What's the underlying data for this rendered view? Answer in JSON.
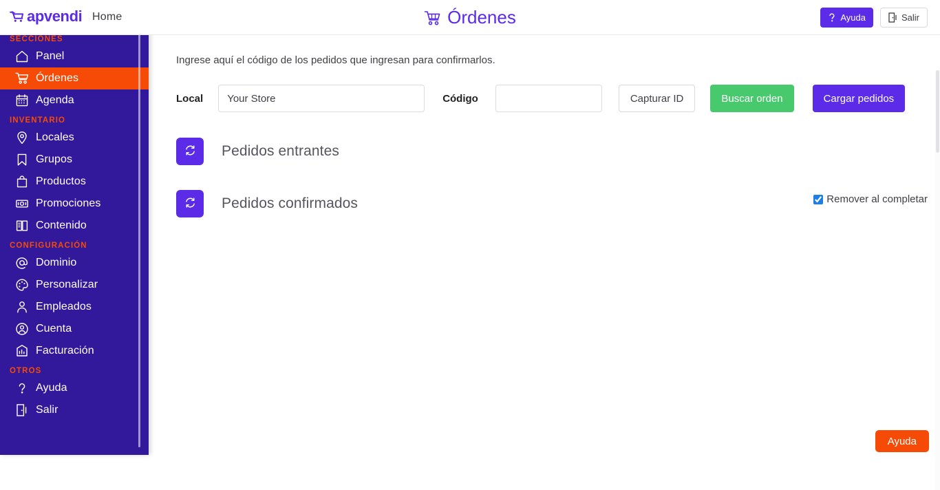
{
  "header": {
    "brand": "apvendi",
    "brand_icon": "shopping-cart-icon",
    "nav_home": "Home",
    "title": "Órdenes",
    "title_icon": "shopping-cart-icon",
    "help_label": "Ayuda",
    "help_icon": "question-mark-icon",
    "exit_label": "Salir",
    "exit_icon": "exit-door-icon",
    "accent_purple": "#5B2BE8"
  },
  "sidebar": {
    "bg_color": "#32189B",
    "active_color": "#F64B06",
    "group_label_color": "#F64B06",
    "groups": [
      {
        "label": "SECCIONES",
        "items": [
          {
            "label": "Panel",
            "icon": "home-icon",
            "active": false
          },
          {
            "label": "Órdenes",
            "icon": "shopping-cart-icon",
            "active": true
          },
          {
            "label": "Agenda",
            "icon": "calendar-icon",
            "active": false
          }
        ]
      },
      {
        "label": "INVENTARIO",
        "items": [
          {
            "label": "Locales",
            "icon": "map-pin-icon",
            "active": false
          },
          {
            "label": "Grupos",
            "icon": "bookmark-icon",
            "active": false
          },
          {
            "label": "Productos",
            "icon": "shopping-bag-icon",
            "active": false
          },
          {
            "label": "Promociones",
            "icon": "banknote-icon",
            "active": false
          },
          {
            "label": "Contenido",
            "icon": "book-icon",
            "active": false
          }
        ]
      },
      {
        "label": "CONFIGURACIÓN",
        "items": [
          {
            "label": "Dominio",
            "icon": "at-sign-icon",
            "active": false
          },
          {
            "label": "Personalizar",
            "icon": "palette-icon",
            "active": false
          },
          {
            "label": "Empleados",
            "icon": "user-icon",
            "active": false
          },
          {
            "label": "Cuenta",
            "icon": "user-circle-icon",
            "active": false
          },
          {
            "label": "Facturación",
            "icon": "receipt-chart-icon",
            "active": false
          }
        ]
      },
      {
        "label": "OTROS",
        "items": [
          {
            "label": "Ayuda",
            "icon": "question-mark-icon",
            "active": false
          },
          {
            "label": "Salir",
            "icon": "exit-door-icon",
            "active": false
          }
        ]
      }
    ]
  },
  "main": {
    "instructions": "Ingrese aquí el código de los pedidos que ingresan para confirmarlos.",
    "form": {
      "local_label": "Local",
      "local_value": "Your Store",
      "codigo_label": "Código",
      "codigo_value": "",
      "codigo_placeholder": "",
      "capture_id_label": "Capturar ID",
      "search_order_label": "Buscar orden",
      "load_orders_label": "Cargar pedidos",
      "green_color": "#48c96e",
      "purple_color": "#5B2BE8"
    },
    "sections": [
      {
        "title": "Pedidos entrantes",
        "refresh_icon": "refresh-icon"
      },
      {
        "title": "Pedidos confirmados",
        "refresh_icon": "refresh-icon"
      }
    ],
    "remove_on_complete": {
      "label": "Remover al completar",
      "checked": true
    }
  },
  "floating_help": {
    "label": "Ayuda",
    "color": "#F64B06"
  }
}
